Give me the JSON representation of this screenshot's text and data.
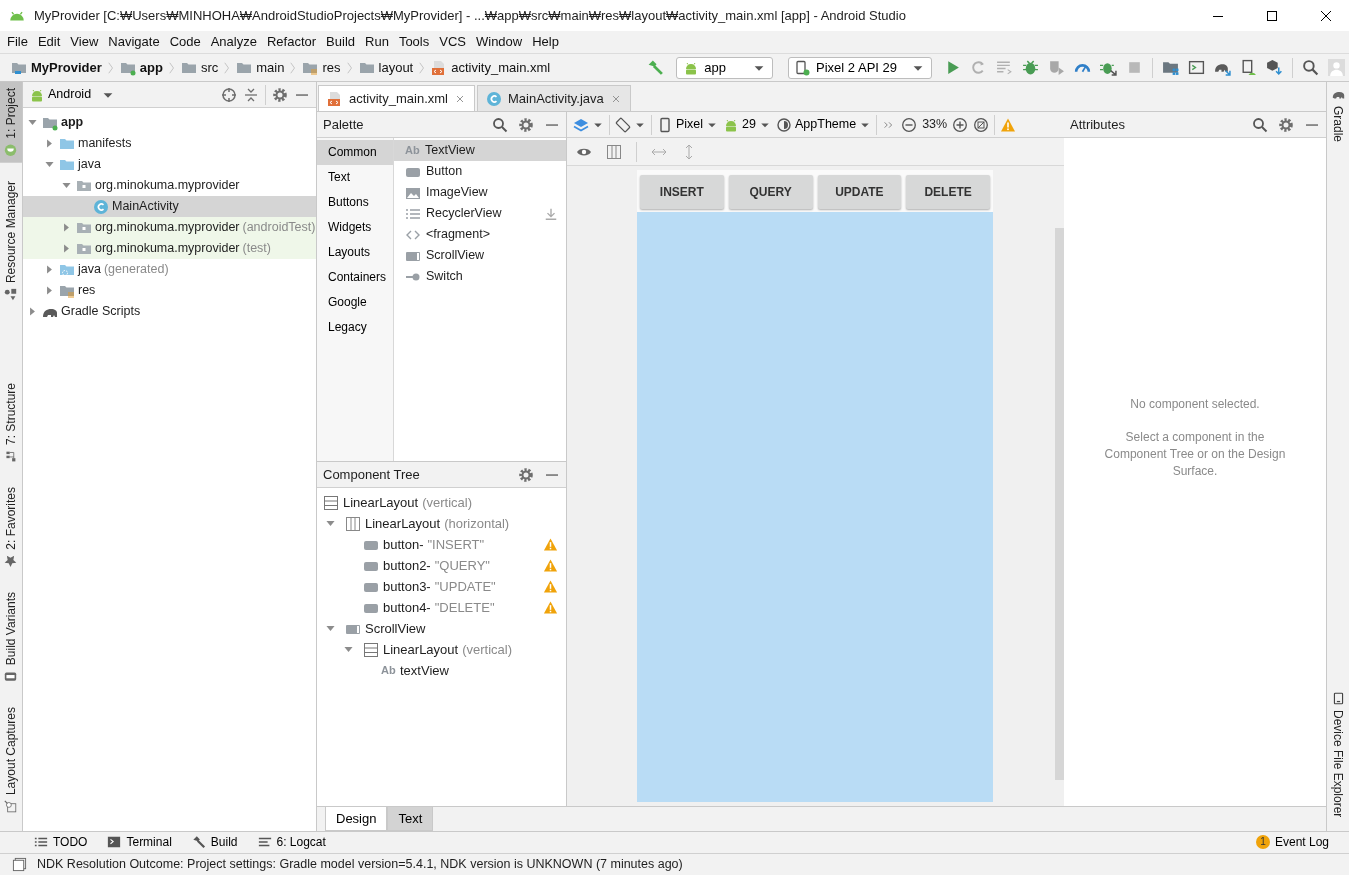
{
  "window": {
    "title": "MyProvider [C:₩Users₩MINHOHA₩AndroidStudioProjects₩MyProvider] - ...₩app₩src₩main₩res₩layout₩activity_main.xml [app] - Android Studio"
  },
  "menu": [
    "File",
    "Edit",
    "View",
    "Navigate",
    "Code",
    "Analyze",
    "Refactor",
    "Build",
    "Run",
    "Tools",
    "VCS",
    "Window",
    "Help"
  ],
  "breadcrumbs": [
    {
      "label": "MyProvider",
      "kind": "project",
      "bold": true
    },
    {
      "label": "app",
      "kind": "module",
      "bold": true
    },
    {
      "label": "src",
      "kind": "folder",
      "bold": false
    },
    {
      "label": "main",
      "kind": "folder",
      "bold": false
    },
    {
      "label": "res",
      "kind": "res",
      "bold": false
    },
    {
      "label": "layout",
      "kind": "folder",
      "bold": false
    },
    {
      "label": "activity_main.xml",
      "kind": "xml",
      "bold": false
    }
  ],
  "toolbar": {
    "run_config": "app",
    "device": "Pixel 2 API 29"
  },
  "left_tool_tabs": {
    "top": [
      {
        "label": "1: Project",
        "kind": "project",
        "selected": true
      },
      {
        "label": "Resource Manager",
        "kind": "resources",
        "selected": false
      }
    ],
    "bottom": [
      {
        "label": "7: Structure",
        "kind": "structure",
        "selected": false
      },
      {
        "label": "2: Favorites",
        "kind": "favorites",
        "selected": false
      },
      {
        "label": "Build Variants",
        "kind": "variants",
        "selected": false
      },
      {
        "label": "Layout Captures",
        "kind": "captures",
        "selected": false
      }
    ]
  },
  "right_tool_tabs": {
    "top": [
      {
        "label": "Gradle",
        "kind": "gradle",
        "selected": false
      }
    ],
    "bottom": [
      {
        "label": "Device File Explorer",
        "kind": "device",
        "selected": false
      }
    ]
  },
  "project_panel": {
    "view": "Android",
    "tree": [
      {
        "label": "app",
        "kind": "module",
        "expanded": true,
        "selected": false,
        "test_source": false,
        "children": [
          {
            "label": "manifests",
            "kind": "folder",
            "expanded": false,
            "selected": false,
            "test_source": false
          },
          {
            "label": "java",
            "kind": "folder",
            "expanded": true,
            "selected": false,
            "test_source": false,
            "children": [
              {
                "label": "org.minokuma.myprovider",
                "kind": "package",
                "expanded": true,
                "selected": false,
                "test_source": false,
                "children": [
                  {
                    "label": "MainActivity",
                    "kind": "class",
                    "selected": true,
                    "test_source": false
                  }
                ]
              },
              {
                "label": "org.minokuma.myprovider",
                "note": "(androidTest)",
                "kind": "package",
                "expanded": false,
                "selected": false,
                "test_source": true
              },
              {
                "label": "org.minokuma.myprovider",
                "note": "(test)",
                "kind": "package",
                "expanded": false,
                "selected": false,
                "test_source": true
              }
            ]
          },
          {
            "label": "java",
            "note": "(generated)",
            "kind": "generated",
            "expanded": false,
            "selected": false,
            "test_source": false
          },
          {
            "label": "res",
            "kind": "res",
            "expanded": false,
            "selected": false,
            "test_source": false
          }
        ]
      },
      {
        "label": "Gradle Scripts",
        "kind": "gradle",
        "expanded": false,
        "selected": false,
        "test_source": false
      }
    ]
  },
  "editor_tabs": [
    {
      "label": "activity_main.xml",
      "kind": "xml",
      "selected": true
    },
    {
      "label": "MainActivity.java",
      "kind": "class",
      "selected": false
    }
  ],
  "palette": {
    "title": "Palette",
    "categories": [
      {
        "label": "Common",
        "selected": true
      },
      {
        "label": "Text",
        "selected": false
      },
      {
        "label": "Buttons",
        "selected": false
      },
      {
        "label": "Widgets",
        "selected": false
      },
      {
        "label": "Layouts",
        "selected": false
      },
      {
        "label": "Containers",
        "selected": false
      },
      {
        "label": "Google",
        "selected": false
      },
      {
        "label": "Legacy",
        "selected": false
      }
    ],
    "items": [
      {
        "label": "TextView",
        "kind": "text",
        "badge": "Ab",
        "selected": true,
        "downloadable": false
      },
      {
        "label": "Button",
        "kind": "button",
        "selected": false,
        "downloadable": false
      },
      {
        "label": "ImageView",
        "kind": "image",
        "selected": false,
        "downloadable": false
      },
      {
        "label": "RecyclerView",
        "kind": "list",
        "selected": false,
        "downloadable": true
      },
      {
        "label": "<fragment>",
        "kind": "fragment",
        "selected": false,
        "downloadable": false
      },
      {
        "label": "ScrollView",
        "kind": "scroll",
        "selected": false,
        "downloadable": false
      },
      {
        "label": "Switch",
        "kind": "switch",
        "selected": false,
        "downloadable": false
      }
    ]
  },
  "component_tree": {
    "title": "Component Tree",
    "nodes": [
      {
        "label": "LinearLayout",
        "note": "(vertical)",
        "kind": "rows",
        "warning": false,
        "children": [
          {
            "label": "LinearLayout",
            "note": "(horizontal)",
            "kind": "columns",
            "expanded": true,
            "warning": false,
            "children": [
              {
                "label": "button-",
                "note": "\"INSERT\"",
                "kind": "button",
                "warning": true
              },
              {
                "label": "button2-",
                "note": "\"QUERY\"",
                "kind": "button",
                "warning": true
              },
              {
                "label": "button3-",
                "note": "\"UPDATE\"",
                "kind": "button",
                "warning": true
              },
              {
                "label": "button4-",
                "note": "\"DELETE\"",
                "kind": "button",
                "warning": true
              }
            ]
          },
          {
            "label": "ScrollView",
            "kind": "scroll",
            "expanded": true,
            "warning": false,
            "children": [
              {
                "label": "LinearLayout",
                "note": "(vertical)",
                "kind": "rows",
                "expanded": true,
                "warning": false,
                "children": [
                  {
                    "label": "textView",
                    "kind": "text",
                    "badge": "Ab",
                    "warning": false
                  }
                ]
              }
            ]
          }
        ]
      }
    ]
  },
  "design_toolbar": {
    "device": "Pixel",
    "api": "29",
    "theme": "AppTheme",
    "zoom": "33%"
  },
  "preview": {
    "buttons": [
      "INSERT",
      "QUERY",
      "UPDATE",
      "DELETE"
    ]
  },
  "attributes": {
    "title": "Attributes",
    "message": "No component selected.",
    "hint": "Select a component in the Component Tree or on the Design Surface."
  },
  "editor_mode_tabs": [
    {
      "label": "Design",
      "selected": true
    },
    {
      "label": "Text",
      "selected": false
    }
  ],
  "bottom_tools": [
    {
      "label": "TODO",
      "kind": "todo"
    },
    {
      "label": "Terminal",
      "kind": "terminal"
    },
    {
      "label": "Build",
      "kind": "build"
    },
    {
      "label": "6: Logcat",
      "kind": "logcat"
    }
  ],
  "event_log": {
    "label": "Event Log",
    "count": "1"
  },
  "status_bar": {
    "text": "NDK Resolution Outcome: Project settings: Gradle model version=5.4.1, NDK version is UNKNOWN (7 minutes ago)"
  }
}
